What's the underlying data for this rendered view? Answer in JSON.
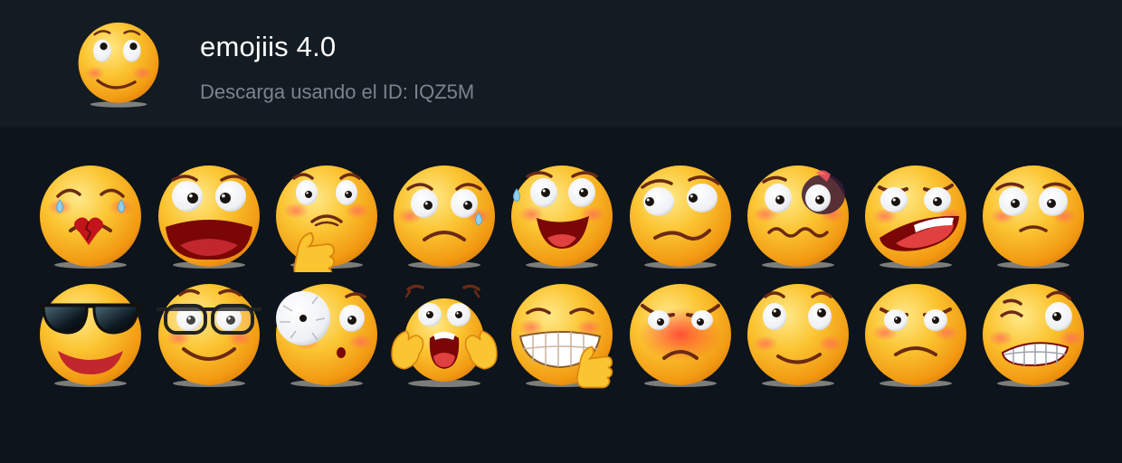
{
  "header": {
    "title": "emojiis 4.0",
    "subtitle": "Descarga usando el ID: IQZ5M",
    "icon": "smiling-blush-emoji"
  },
  "colors": {
    "background": "#0d141b",
    "header_background": "#131b23",
    "title": "#ffffff",
    "subtitle": "#7b838c",
    "emoji_face": "#f9b320"
  },
  "stickers": [
    {
      "name": "broken-heart-sad-emoji"
    },
    {
      "name": "shocked-open-mouth-emoji"
    },
    {
      "name": "thinking-hand-chin-emoji"
    },
    {
      "name": "sad-tear-emoji"
    },
    {
      "name": "nervous-laugh-sweat-emoji"
    },
    {
      "name": "side-eye-skeptical-emoji"
    },
    {
      "name": "black-eye-wavy-mouth-emoji"
    },
    {
      "name": "angry-shouting-emoji"
    },
    {
      "name": "worried-pleading-emoji"
    },
    {
      "name": "sunglasses-smile-emoji"
    },
    {
      "name": "glasses-smile-emoji"
    },
    {
      "name": "cracked-eye-whistle-emoji"
    },
    {
      "name": "screaming-hands-face-emoji"
    },
    {
      "name": "grinning-thumbs-up-emoji"
    },
    {
      "name": "angry-frown-emoji"
    },
    {
      "name": "blushing-smile-emoji"
    },
    {
      "name": "annoyed-frown-emoji"
    },
    {
      "name": "grimacing-teeth-emoji"
    }
  ]
}
